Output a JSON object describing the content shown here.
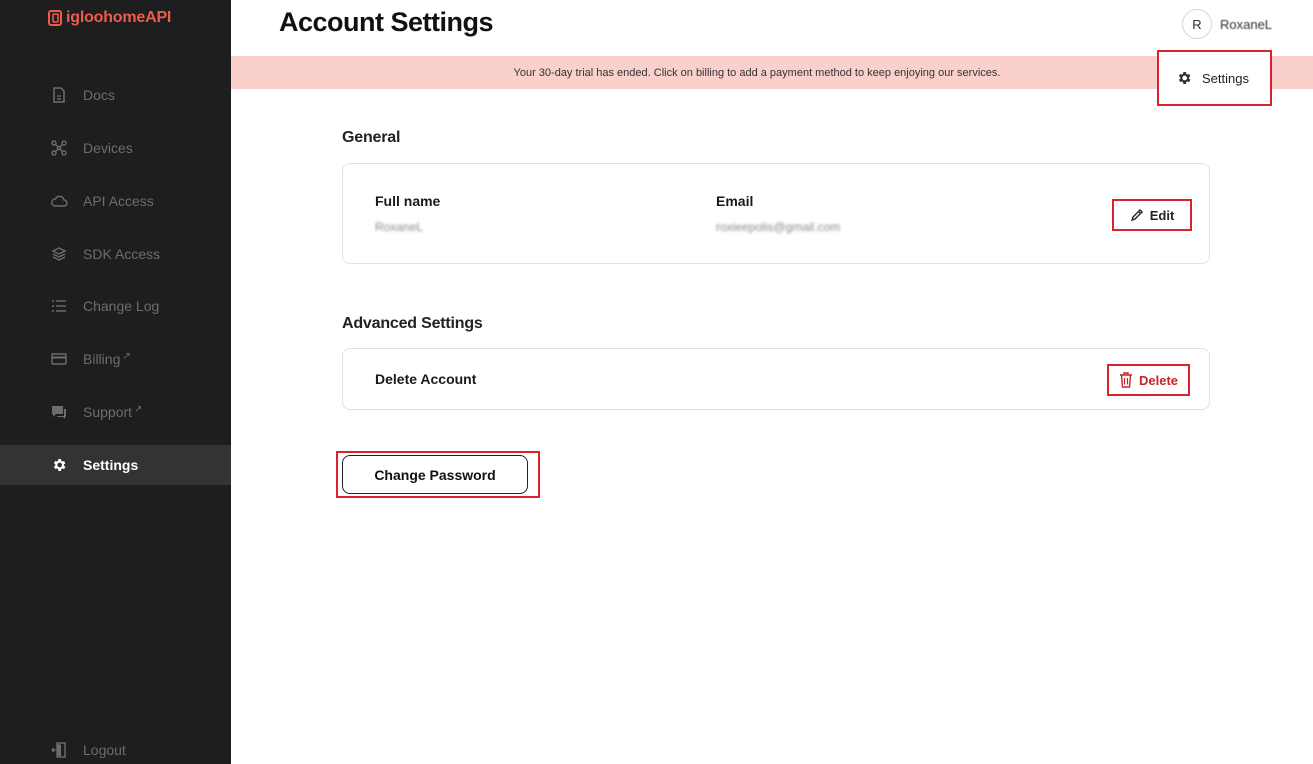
{
  "brand": {
    "name": "igloohomeAPI",
    "color": "#ef5a4c"
  },
  "sidebar": {
    "items": [
      {
        "label": "Docs",
        "icon": "document-icon"
      },
      {
        "label": "Devices",
        "icon": "devices-icon"
      },
      {
        "label": "API Access",
        "icon": "cloud-icon"
      },
      {
        "label": "SDK Access",
        "icon": "layers-icon"
      },
      {
        "label": "Change Log",
        "icon": "list-icon"
      },
      {
        "label": "Billing",
        "icon": "card-icon",
        "external": "↗"
      },
      {
        "label": "Support",
        "icon": "chat-icon",
        "external": "↗"
      },
      {
        "label": "Settings",
        "icon": "gear-icon",
        "active": true
      }
    ],
    "logout_label": "Logout"
  },
  "header": {
    "title": "Account Settings",
    "avatar_initial": "R",
    "username": "RoxaneL"
  },
  "banner": {
    "text": "Your 30-day trial has ended. Click on billing to add a payment method to keep enjoying our services."
  },
  "settings_link": {
    "label": "Settings"
  },
  "general": {
    "title": "General",
    "full_name_label": "Full name",
    "full_name_value": "RoxaneL",
    "email_label": "Email",
    "email_value": "roxieepolis@gmail.com",
    "edit_label": "Edit"
  },
  "advanced": {
    "title": "Advanced Settings",
    "delete_account_label": "Delete Account",
    "delete_label": "Delete"
  },
  "change_password_label": "Change Password",
  "colors": {
    "sidebar_bg": "#1e1e1e",
    "active_item_bg": "#333333",
    "banner_bg": "#f9d0cc",
    "highlight": "#d9232d",
    "danger": "#c9222b"
  }
}
